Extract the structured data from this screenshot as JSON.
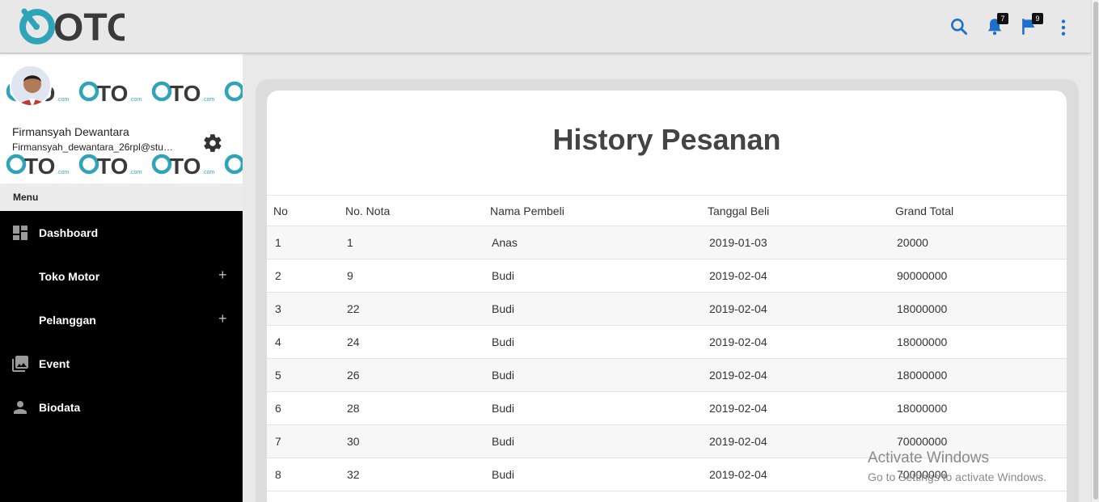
{
  "header": {
    "logo_text": "OTO",
    "notifications_badge": "7",
    "flags_badge": "9"
  },
  "profile": {
    "name": "Firmansyah Dewantara",
    "email": "Firmansyah_dewantara_26rpl@stud...",
    "pattern_logo_text": "OTO.com"
  },
  "sidebar": {
    "menu_label": "Menu",
    "items": [
      {
        "label": "Dashboard",
        "icon": "dashboard-icon",
        "expandable": false
      },
      {
        "label": "Toko Motor",
        "icon": "",
        "expandable": true
      },
      {
        "label": "Pelanggan",
        "icon": "",
        "expandable": true
      },
      {
        "label": "Event",
        "icon": "photo-library-icon",
        "expandable": false
      },
      {
        "label": "Biodata",
        "icon": "person-icon",
        "expandable": false
      }
    ],
    "expand_symbol": "+"
  },
  "main": {
    "title": "History Pesanan",
    "columns": [
      "No",
      "No. Nota",
      "Nama Pembeli",
      "Tanggal Beli",
      "Grand Total"
    ],
    "rows": [
      [
        "1",
        "1",
        "Anas",
        "2019-01-03",
        "20000"
      ],
      [
        "2",
        "9",
        "Budi",
        "2019-02-04",
        "90000000"
      ],
      [
        "3",
        "22",
        "Budi",
        "2019-02-04",
        "18000000"
      ],
      [
        "4",
        "24",
        "Budi",
        "2019-02-04",
        "18000000"
      ],
      [
        "5",
        "26",
        "Budi",
        "2019-02-04",
        "18000000"
      ],
      [
        "6",
        "28",
        "Budi",
        "2019-02-04",
        "18000000"
      ],
      [
        "7",
        "30",
        "Budi",
        "2019-02-04",
        "70000000"
      ],
      [
        "8",
        "32",
        "Budi",
        "2019-02-04",
        "70000000"
      ]
    ]
  },
  "watermark": {
    "line1": "Activate Windows",
    "line2": "Go to Settings to activate Windows."
  },
  "colors": {
    "brand_teal": "#2fa3b8",
    "brand_dark": "#3a3a3a",
    "icon_blue": "#1e6fc9"
  }
}
